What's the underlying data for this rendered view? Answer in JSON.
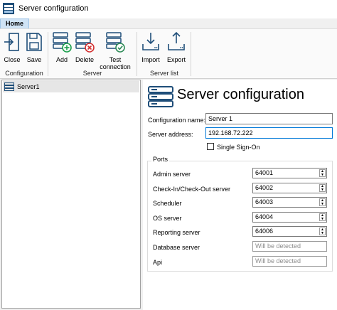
{
  "window": {
    "title": "Server configuration"
  },
  "ribbon": {
    "tab_home": "Home",
    "groups": {
      "configuration": "Configuration",
      "server": "Server",
      "server_list": "Server list"
    },
    "buttons": {
      "close": "Close",
      "save": "Save",
      "add": "Add",
      "delete": "Delete",
      "test_line1": "Test",
      "test_line2": "connection",
      "import": "Import",
      "export": "Export"
    }
  },
  "tree": {
    "items": [
      {
        "label": "Server1"
      }
    ]
  },
  "form": {
    "title": "Server configuration",
    "config_name_label": "Configuration name:",
    "config_name_value": "Server 1",
    "server_address_label": "Server address:",
    "server_address_value": "192.168.72.222",
    "sso_label": "Single Sign-On",
    "sso_checked": false,
    "ports_legend": "Ports",
    "ports": [
      {
        "label": "Admin server",
        "value": "64001"
      },
      {
        "label": "Check-In/Check-Out server",
        "value": "64002"
      },
      {
        "label": "Scheduler",
        "value": "64003"
      },
      {
        "label": "OS server",
        "value": "64004"
      },
      {
        "label": "Reporting server",
        "value": "64006"
      },
      {
        "label": "Database server",
        "placeholder": "Will be detected"
      },
      {
        "label": "Api",
        "placeholder": "Will be detected"
      }
    ]
  },
  "icons": {
    "app": "server-config-app-icon",
    "close": "exit-door-icon",
    "save": "floppy-disk-icon",
    "add": "server-add-icon",
    "delete": "server-delete-icon",
    "test": "server-check-icon",
    "import": "import-tray-icon",
    "export": "export-tray-icon",
    "tree_server": "server-icon",
    "header": "server-stack-icon"
  },
  "colors": {
    "accent": "#0078d7",
    "ribbon_icon": "#1f4e79",
    "add_green": "#1a9e4b",
    "delete_red": "#d32f2f",
    "check_green": "#2e8b57"
  }
}
